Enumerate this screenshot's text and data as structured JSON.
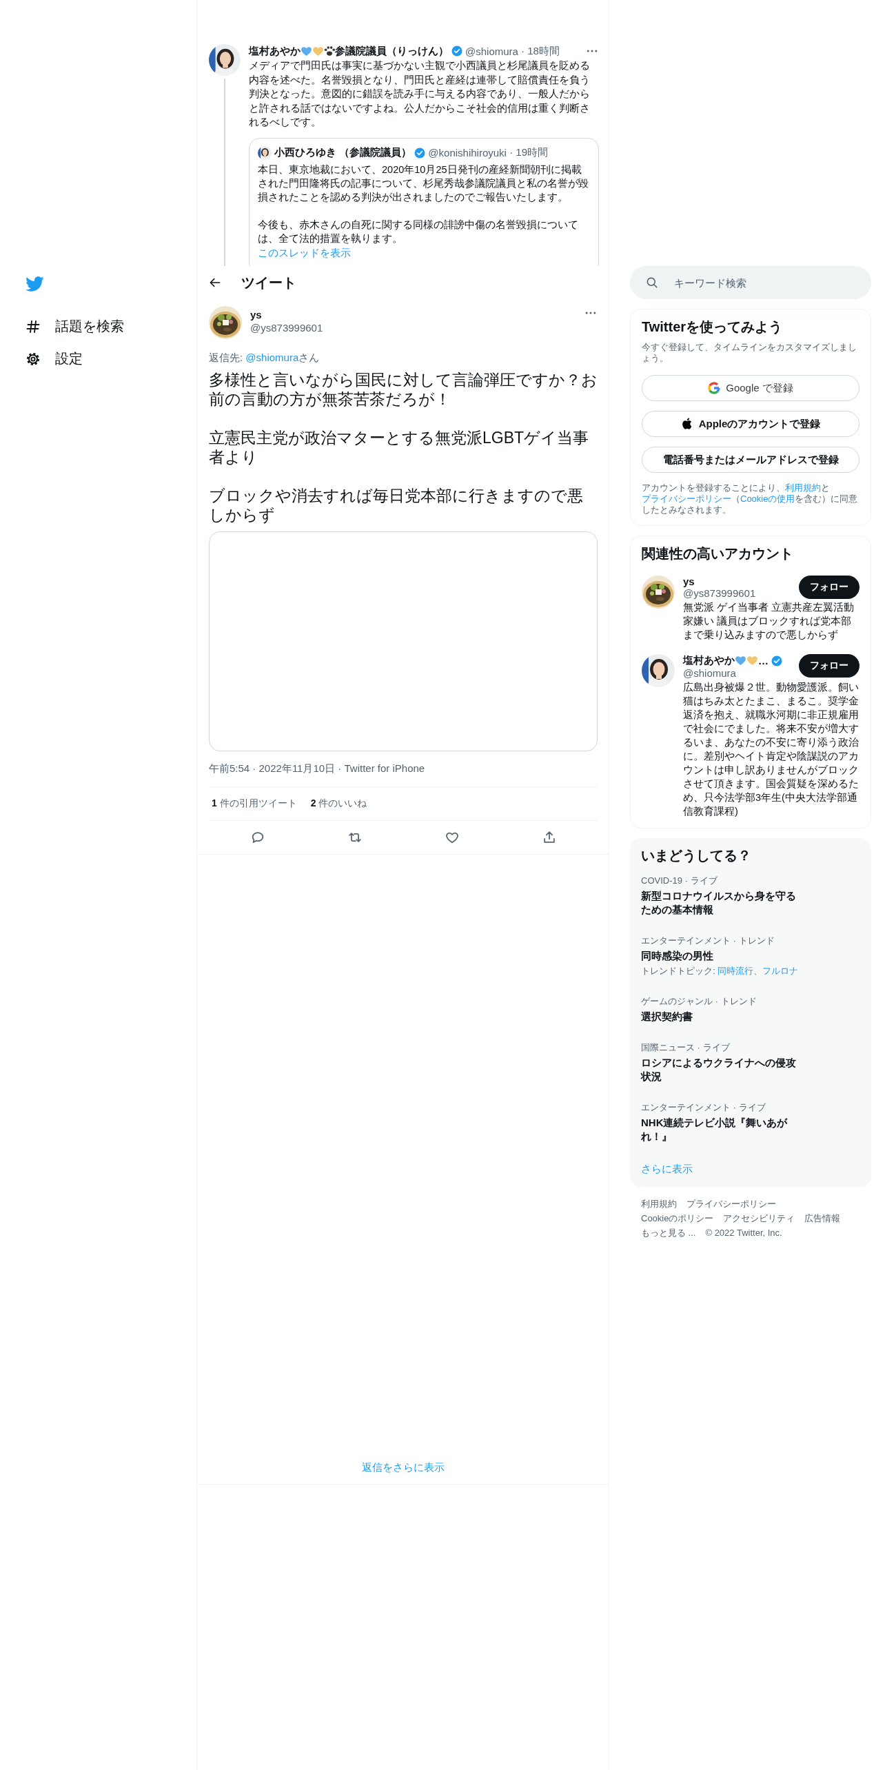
{
  "sidebar": {
    "items": [
      {
        "kind": "explore",
        "label": "話題を検索"
      },
      {
        "kind": "settings",
        "label": "設定"
      }
    ]
  },
  "thread_tweet": {
    "avatar": {
      "kind": "person"
    },
    "name": "塩村あやか",
    "emoji": [
      {
        "kind": "blue_heart"
      },
      {
        "kind": "yellow_heart"
      },
      {
        "kind": "paw"
      }
    ],
    "name_suffix": "参議院議員（りっけん）",
    "verified": true,
    "handle": "@shiomura",
    "time": "· 18時間",
    "text": "メディアで門田氏は事実に基づかない主観で小西議員と杉尾議員を貶める内容を述べた。名誉毀損となり、門田氏と産経は連帯して賠償責任を負う判決となった。意図的に錯誤を読み手に与える内容であり、一般人だからと許される話ではないですよね。公人だからこそ社会的信用は重く判断されるべしです。",
    "quote": {
      "avatar": {
        "kind": "person"
      },
      "name": "小西ひろゆき （参議院議員）",
      "verified": true,
      "handle": "@konishihiroyuki",
      "time": "· 19時間",
      "paragraphs": [
        "本日、東京地裁において、2020年10月25日発刊の産経新聞朝刊に掲載された門田隆将氏の記事について、杉尾秀哉参議院議員と私の名誉が毀損されたことを認める判決が出されましたのでご報告いたします。",
        "今後も、赤木さんの自死に関する同様の誹謗中傷の名誉毀損については、全て法的措置を執ります。"
      ],
      "link": "このスレッドを表示"
    }
  },
  "header": {
    "title": "ツイート"
  },
  "tweet": {
    "avatar": {
      "kind": "food"
    },
    "name": "ys",
    "handle": "@ys873999601",
    "reply_to": [
      {
        "kind": "text",
        "text": "返信先: "
      },
      {
        "kind": "link",
        "text": "@shiomura"
      },
      {
        "kind": "text",
        "text": "さん"
      }
    ],
    "paragraphs": [
      "多様性と言いながら国民に対して言論弾圧ですか？お前の言動の方が無茶苦茶だろが！",
      "立憲民主党が政治マターとする無党派LGBTゲイ当事者より",
      "ブロックや消去すれば毎日党本部に行きますので悪しからず"
    ],
    "timestamp": "午前5:54 · 2022年11月10日 · Twitter for iPhone",
    "stats": [
      {
        "count": "1",
        "label": "件の引用ツイート"
      },
      {
        "count": "2",
        "label": "件のいいね"
      }
    ],
    "actions": [
      {
        "kind": "reply"
      },
      {
        "kind": "retweet"
      },
      {
        "kind": "like"
      },
      {
        "kind": "share"
      }
    ]
  },
  "more_replies": "返信をさらに表示",
  "search": {
    "placeholder": "キーワード検索"
  },
  "signup": {
    "title": "Twitterを使ってみよう",
    "subtitle": "今すぐ登録して、タイムラインをカスタマイズしましょう。",
    "buttons": [
      {
        "kind": "google",
        "label": "Google で登録"
      },
      {
        "kind": "apple",
        "label": "Appleのアカウントで登録"
      },
      {
        "kind": "phone",
        "label": "電話番号またはメールアドレスで登録"
      }
    ],
    "legal": [
      {
        "kind": "text",
        "text": "アカウントを登録することにより、"
      },
      {
        "kind": "link",
        "text": "利用規約"
      },
      {
        "kind": "text",
        "text": "と"
      },
      {
        "kind": "link",
        "text": "プライバシーポリシー"
      },
      {
        "kind": "text",
        "text": "（"
      },
      {
        "kind": "link",
        "text": "Cookieの使用"
      },
      {
        "kind": "text",
        "text": "を含む）に同意したとみなされます。"
      }
    ]
  },
  "related": {
    "title": "関連性の高いアカウント",
    "accounts": [
      {
        "avatar": {
          "kind": "food"
        },
        "name": "ys",
        "verified": false,
        "handle": "@ys873999601",
        "button": "フォロー",
        "bio": "無党派 ゲイ当事者 立憲共産左翼活動家嫌い 議員はブロックすれば党本部まで乗り込みますので悪しからず"
      },
      {
        "avatar": {
          "kind": "person"
        },
        "name": "塩村あやか",
        "emoji": [
          {
            "kind": "blue_heart"
          },
          {
            "kind": "yellow_heart"
          }
        ],
        "name_tail": "…",
        "verified": true,
        "handle": "@shiomura",
        "button": "フォロー",
        "bio": "広島出身被爆２世。動物愛護派。飼い猫はちみ太とたまこ、まるこ。奨学金返済を抱え、就職氷河期に非正規雇用で社会にでました。将来不安が増大するいま、あなたの不安に寄り添う政治に。差別やヘイト肯定や陰謀説のアカウントは申し訳ありませんがブロックさせて頂きます。国会質疑を深めるため、只今法学部3年生(中央大法学部通信教育課程)"
      }
    ]
  },
  "trends": {
    "title": "いまどうしてる？",
    "items": [
      {
        "context": "COVID-19 · ライブ",
        "title": "新型コロナウイルスから身を守るための基本情報"
      },
      {
        "context": "エンターテインメント · トレンド",
        "title": "同時感染の男性",
        "topics": [
          {
            "kind": "text",
            "text": "トレンドトピック: "
          },
          {
            "kind": "link",
            "text": "同時流行"
          },
          {
            "kind": "text",
            "text": "、"
          },
          {
            "kind": "link",
            "text": "フルロナ"
          }
        ]
      },
      {
        "context": "ゲームのジャンル · トレンド",
        "title": "選択契約書"
      },
      {
        "context": "国際ニュース · ライブ",
        "title": "ロシアによるウクライナへの侵攻状況"
      },
      {
        "context": "エンターテインメント · ライブ",
        "title": "NHK連続テレビ小説『舞いあがれ！』"
      }
    ],
    "more": "さらに表示"
  },
  "footer": {
    "links": [
      "利用規約",
      "プライバシーポリシー",
      "Cookieのポリシー",
      "アクセシビリティ",
      "広告情報",
      "もっと見る ..."
    ],
    "copyright": "© 2022 Twitter, Inc."
  }
}
